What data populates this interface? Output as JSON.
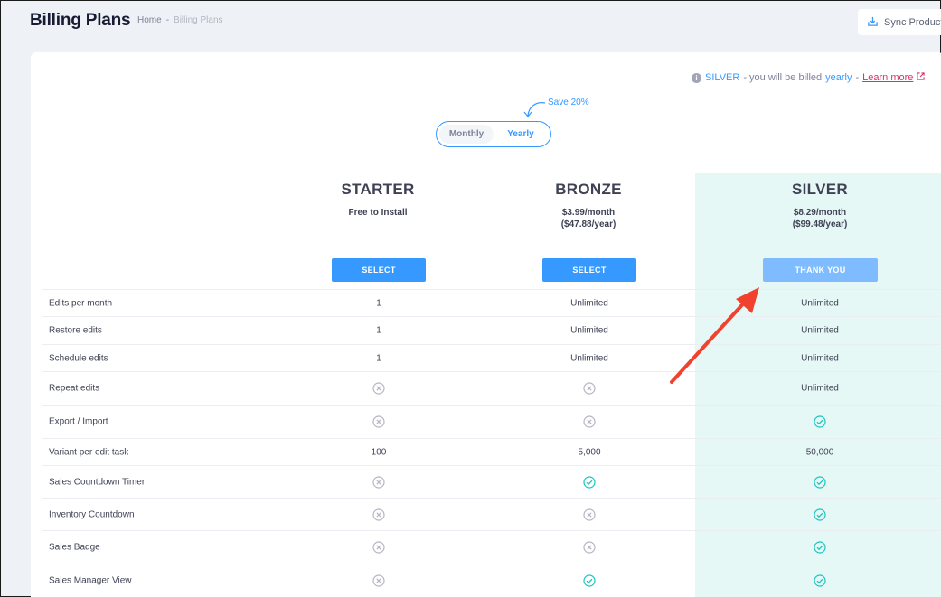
{
  "header": {
    "title": "Billing Plans",
    "breadcrumb": {
      "home": "Home",
      "separator": "-",
      "current": "Billing Plans"
    },
    "sync_button": {
      "label": "Sync Products",
      "icon": "download-icon"
    }
  },
  "billing_note": {
    "icon": "info-icon",
    "plan": "SILVER",
    "text_before": "- you will be billed",
    "cycle": "yearly",
    "text_after": "-",
    "link": "Learn more",
    "link_icon": "external-link-icon"
  },
  "billing_toggle": {
    "save_label": "Save 20%",
    "monthly_label": "Monthly",
    "yearly_label": "Yearly",
    "selected": "Yearly"
  },
  "plans": [
    {
      "name": "STARTER",
      "price_line1": "Free to Install",
      "price_line2": "",
      "button": "SELECT"
    },
    {
      "name": "BRONZE",
      "price_line1": "$3.99/month",
      "price_line2": "($47.88/year)",
      "button": "SELECT"
    },
    {
      "name": "SILVER",
      "price_line1": "$8.29/month",
      "price_line2": "($99.48/year)",
      "button": "THANK YOU"
    }
  ],
  "features": [
    {
      "label": "Edits per month",
      "values": [
        "1",
        "Unlimited",
        "Unlimited"
      ]
    },
    {
      "label": "Restore edits",
      "values": [
        "1",
        "Unlimited",
        "Unlimited"
      ]
    },
    {
      "label": "Schedule edits",
      "values": [
        "1",
        "Unlimited",
        "Unlimited"
      ]
    },
    {
      "label": "Repeat edits",
      "values": [
        "cross",
        "cross",
        "Unlimited"
      ]
    },
    {
      "label": "Export / Import",
      "values": [
        "cross",
        "cross",
        "check"
      ]
    },
    {
      "label": "Variant per edit task",
      "values": [
        "100",
        "5,000",
        "50,000"
      ]
    },
    {
      "label": "Sales Countdown Timer",
      "values": [
        "cross",
        "check",
        "check"
      ]
    },
    {
      "label": "Inventory Countdown",
      "values": [
        "cross",
        "cross",
        "check"
      ]
    },
    {
      "label": "Sales Badge",
      "values": [
        "cross",
        "cross",
        "check"
      ]
    },
    {
      "label": "Sales Manager View",
      "values": [
        "cross",
        "check",
        "check"
      ]
    }
  ],
  "colors": {
    "accent": "#3699ff",
    "check": "#1bc5bd",
    "cross": "#b5b5c3",
    "highlight_column": "#e6f8f6",
    "annotation_arrow": "#f1412f"
  }
}
